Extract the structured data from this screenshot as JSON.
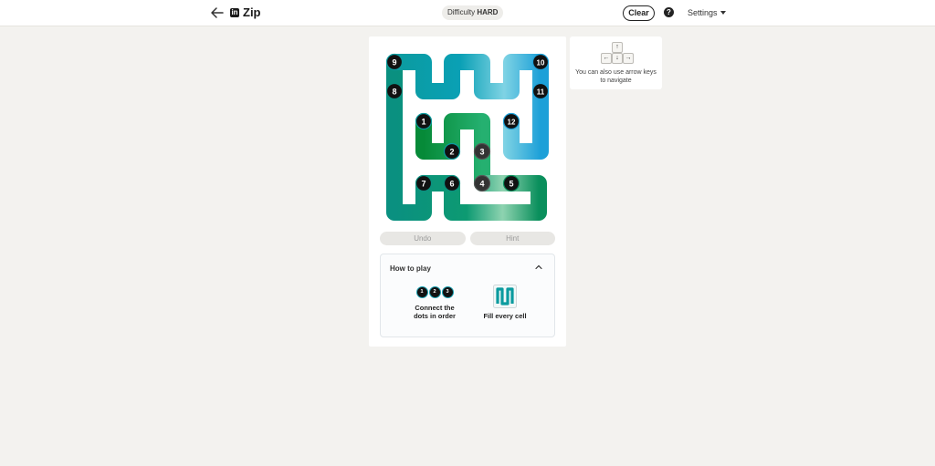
{
  "header": {
    "app_title": "Zip",
    "logo_text": "in",
    "difficulty_prefix": "Difficulty",
    "difficulty_value": "HARD",
    "clear_label": "Clear",
    "help_glyph": "?",
    "settings_label": "Settings"
  },
  "board": {
    "dots": [
      {
        "label": "1"
      },
      {
        "label": "2"
      },
      {
        "label": "3"
      },
      {
        "label": "4"
      },
      {
        "label": "5"
      },
      {
        "label": "6"
      },
      {
        "label": "7"
      },
      {
        "label": "8"
      },
      {
        "label": "9"
      },
      {
        "label": "10"
      },
      {
        "label": "11"
      },
      {
        "label": "12"
      }
    ]
  },
  "controls": {
    "undo_label": "Undo",
    "hint_label": "Hint"
  },
  "how_to_play": {
    "title": "How to play",
    "mini_dots": [
      "1",
      "2",
      "3"
    ],
    "item_connect_line1": "Connect the",
    "item_connect_line2": "dots in order",
    "item_fill": "Fill every cell"
  },
  "tip": {
    "keys": [
      "↑",
      "←",
      "↓",
      "→"
    ],
    "text": "You can also use arrow keys to navigate"
  },
  "colors": {
    "teal": "#0b9b9f",
    "green": "#0a8f3c",
    "blue": "#1da0d8",
    "dot": "#111111",
    "background": "#f3f2ef"
  }
}
